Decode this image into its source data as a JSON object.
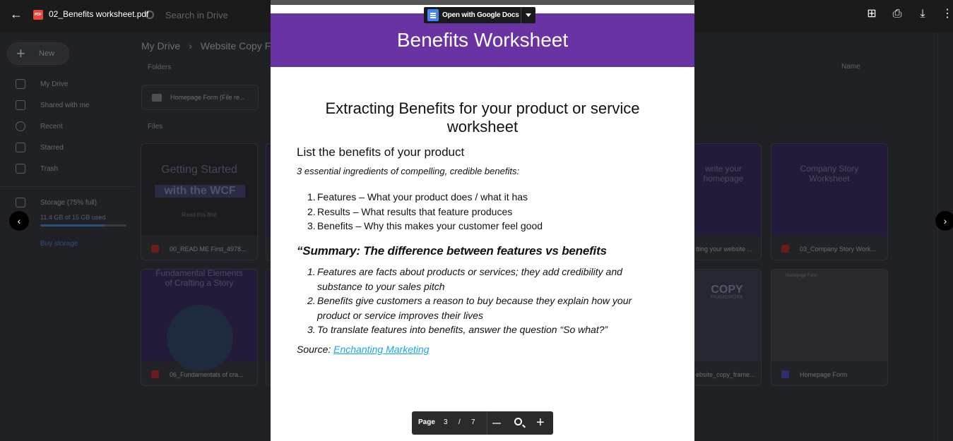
{
  "viewer": {
    "file_name": "02_Benefits worksheet.pdf",
    "file_type_badge": "PDF",
    "open_with_label": "Open with Google Docs"
  },
  "drive": {
    "search_placeholder": "Search in Drive",
    "new_label": "New",
    "nav": [
      {
        "label": "My Drive",
        "icon": "drive-icon"
      },
      {
        "label": "Shared with me",
        "icon": "people-icon"
      },
      {
        "label": "Recent",
        "icon": "clock-icon"
      },
      {
        "label": "Starred",
        "icon": "star-icon"
      },
      {
        "label": "Trash",
        "icon": "trash-icon"
      }
    ],
    "storage_label": "Storage (75% full)",
    "storage_fraction": 0.75,
    "storage_used": "11.4 GB of 15 GB used",
    "buy_storage": "Buy storage",
    "breadcrumb": [
      "My Drive",
      "Website Copy Fr"
    ],
    "folders_label": "Folders",
    "files_label": "Files",
    "sort_label": "Name",
    "folder": "Homepage Form (File re...",
    "files": [
      {
        "thumb_title": "Getting Started",
        "thumb_sub": "with the WCF",
        "thumb_note": "Read this first",
        "caption": "00_READ ME First_4978..."
      },
      {
        "thumb_title": "write your homepage",
        "caption": "tting your website ..."
      },
      {
        "thumb_title": "Company Story Worksheet",
        "caption": "03_Company Story Work..."
      },
      {
        "thumb_title": "Fundamental Elements of Crafting a Story",
        "caption": "06_Fundamentals of cra..."
      },
      {
        "thumb_title": "COPY",
        "thumb_sub": "FRAMEWORK",
        "caption": "ebsite_copy_frame..."
      },
      {
        "thumb_title": "Homepage Form",
        "caption": "Homepage Form"
      }
    ]
  },
  "document": {
    "banner_title": "Benefits Worksheet",
    "heading": "Extracting Benefits for your product or service worksheet",
    "subheading": "List the benefits of your product",
    "ingredients_intro": "3 essential ingredients of compelling, credible benefits:",
    "ingredients": [
      "Features – What your product does / what it has",
      "Results – What results that feature produces",
      "Benefits – Why this makes your customer feel good"
    ],
    "summary_heading": "“Summary: The difference between features vs benefits",
    "summary_points": [
      "Features are facts about products or services; they add credibility and substance to your sales pitch",
      "Benefits give customers a reason to buy because they explain how your product or service improves their lives",
      "To translate features into benefits, answer the question “So what?”"
    ],
    "source_label": "Source: ",
    "source_link": "Enchanting Marketing"
  },
  "page_control": {
    "label": "Page",
    "current": "3",
    "separator": "/",
    "total": "7"
  }
}
